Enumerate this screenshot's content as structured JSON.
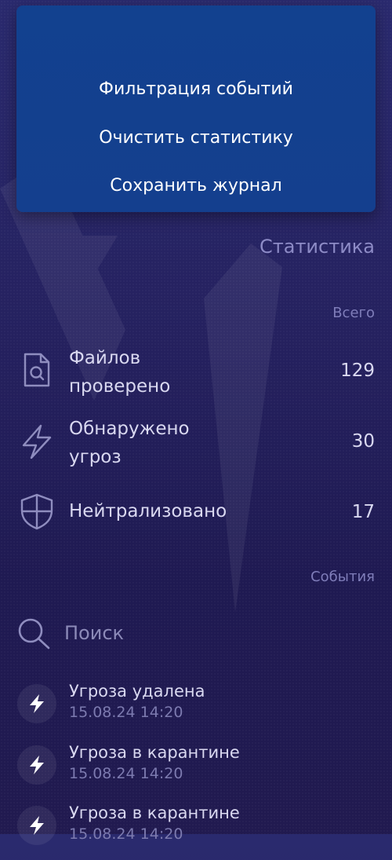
{
  "menu": {
    "items": [
      {
        "label": "Фильтрация событий"
      },
      {
        "label": "Очистить статистику"
      },
      {
        "label": "Сохранить журнал"
      }
    ]
  },
  "statistics": {
    "title": "Статистика",
    "total_label": "Всего",
    "rows": [
      {
        "label_line1": "Файлов",
        "label_line2": "проверено",
        "value": "129",
        "icon": "file-search-icon"
      },
      {
        "label_line1": "Обнаружено",
        "label_line2": "угроз",
        "value": "30",
        "icon": "lightning-icon"
      },
      {
        "label_line1": "Нейтрализовано",
        "label_line2": "",
        "value": "17",
        "icon": "shield-icon"
      }
    ]
  },
  "events": {
    "label": "События",
    "search_placeholder": "Поиск",
    "items": [
      {
        "title": "Угроза удалена",
        "time": "15.08.24 14:20",
        "icon": "lightning-icon"
      },
      {
        "title": "Угроза в карантине",
        "time": "15.08.24 14:20",
        "icon": "lightning-icon"
      },
      {
        "title": "Угроза в карантине",
        "time": "15.08.24 14:20",
        "icon": "lightning-icon"
      }
    ]
  },
  "colors": {
    "background": "#25215f",
    "menu_background": "#12418f",
    "muted_text": "#8d8bc6"
  }
}
